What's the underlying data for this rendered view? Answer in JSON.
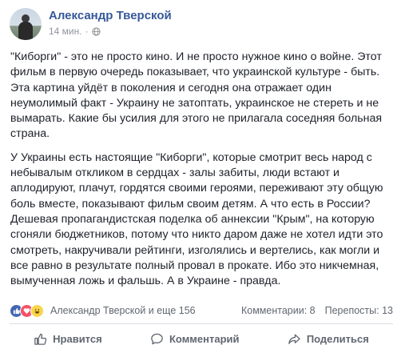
{
  "post": {
    "author": "Александр Тверской",
    "time": "14 мин.",
    "separator": "·",
    "paragraphs": [
      "\"Киборги\" - это не просто кино. И не просто нужное кино о войне. Этот фильм в первую очередь показывает, что украинской культуре - быть. Эта картина уйдёт в поколения и сегодня она отражает один неумолимый факт - Украину не затоптать, украинское не стереть и не вымарать. Какие бы усилия для этого не прилагала соседняя больная страна.",
      "У Украины есть настоящие \"Киборги\", которые смотрит весь народ с небывалым откликом в сердцах - залы забиты, люди встают и аплодируют, плачут, гордятся своими героями, переживают эту общую боль вместе, показывают фильм своим детям. А что есть в России? Дешевая пропагандистская поделка об аннексии \"Крым\", на которую сгоняли бюджетников, потому что никто даром даже не хотел идти это смотреть, накручивали рейтинги, изголялись и вертелись, как могли и все равно в результате полный провал в прокате. Ибо это никчемная, вымученная ложь и фальшь. А в Украине - правда."
    ]
  },
  "reactions": {
    "summary": "Александр Тверской и еще 156",
    "comments": "Комментарии: 8",
    "shares": "Перепосты: 13",
    "icons": [
      "like-icon",
      "love-icon",
      "haha-icon"
    ]
  },
  "actions": {
    "like": "Нравится",
    "comment": "Комментарий",
    "share": "Поделиться"
  },
  "colors": {
    "author": "#365899",
    "like": "#4267b2",
    "love": "#f25268",
    "haha": "#f7d44c"
  }
}
